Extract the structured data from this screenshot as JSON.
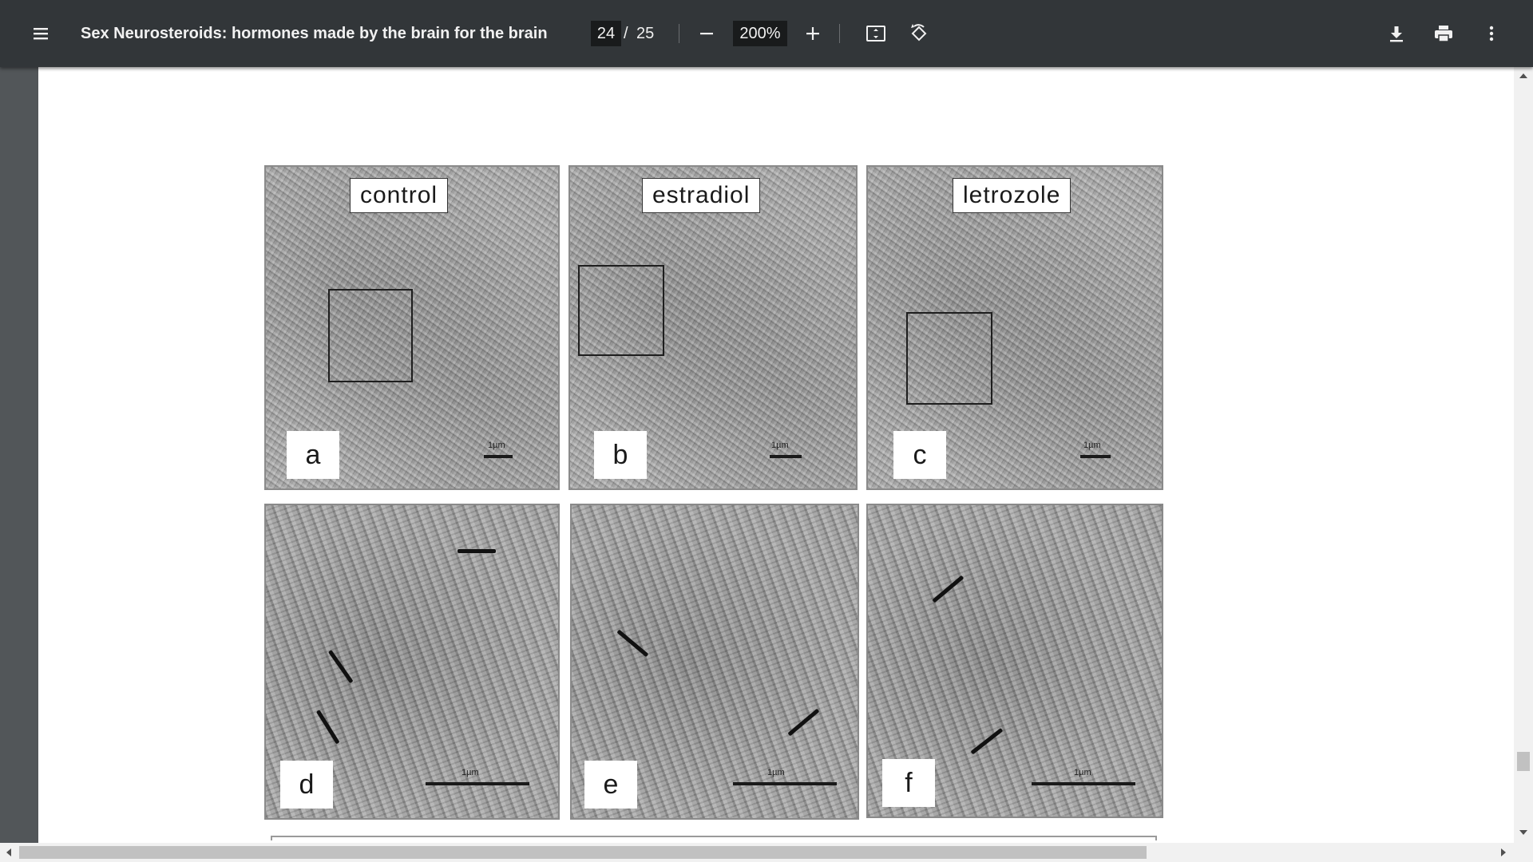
{
  "toolbar": {
    "title": "Sex Neurosteroids: hormones made by the brain for the brain",
    "page_current": "24",
    "page_separator": "/",
    "page_total": "25",
    "zoom": "200%",
    "icons": [
      "menu-icon",
      "zoom-out-icon",
      "zoom-in-icon",
      "fit-page-icon",
      "rotate-icon",
      "download-icon",
      "print-icon",
      "more-icon"
    ]
  },
  "figure": {
    "conditions": [
      "control",
      "estradiol",
      "letrozole"
    ],
    "panels": [
      {
        "letter": "a",
        "scale": "1µm"
      },
      {
        "letter": "b",
        "scale": "1µm"
      },
      {
        "letter": "c",
        "scale": "1µm"
      },
      {
        "letter": "d",
        "scale": "1µm"
      },
      {
        "letter": "e",
        "scale": "1µm"
      },
      {
        "letter": "f",
        "scale": "1µm"
      }
    ]
  },
  "colors": {
    "toolbar_bg": "#323639",
    "viewer_bg": "#525659",
    "page_bg": "#ffffff",
    "scroll_track": "#f1f1f1",
    "scroll_thumb": "#c1c1c1"
  }
}
